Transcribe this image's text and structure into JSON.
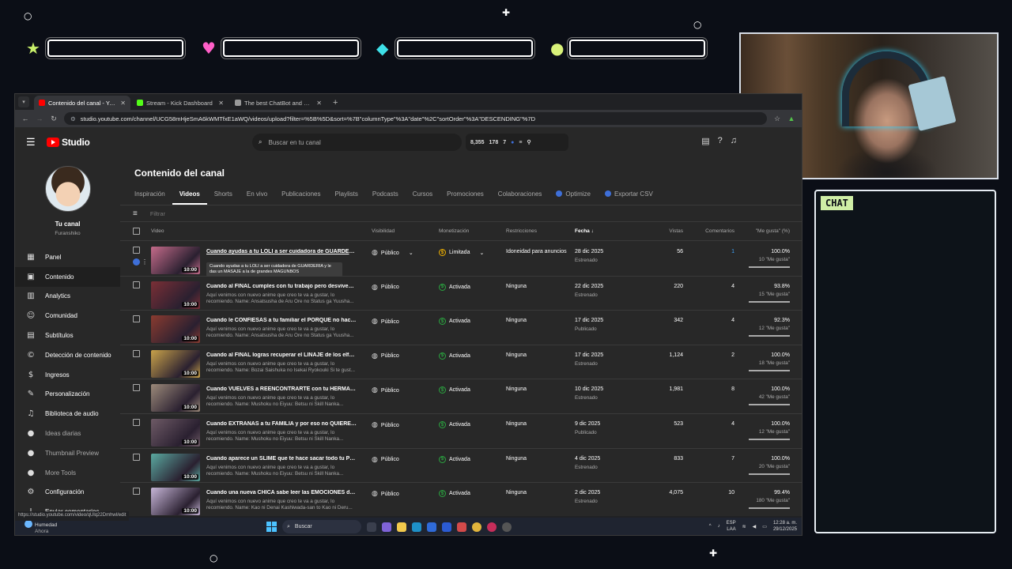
{
  "overlay": {
    "chat_label": "CHAT",
    "stat_icons": [
      "star-icon",
      "heart-icon",
      "gem-icon",
      "orb-icon"
    ],
    "colors": {
      "star": "#c8f06a",
      "heart": "#ff5fc8",
      "gem": "#3ee0e8",
      "orb": "#d9f27a"
    }
  },
  "browser": {
    "tabs": [
      {
        "title": "Contenido del canal - YouTube",
        "active": true,
        "favicon_color": "#ff0000"
      },
      {
        "title": "Stream - Kick Dashboard",
        "active": false,
        "favicon_color": "#53fc18"
      },
      {
        "title": "The best ChatBot and Widgets",
        "active": false,
        "favicon_color": "#999999"
      }
    ],
    "url": "studio.youtube.com/channel/UCG58mHjeSmA6kWMTfxE1aWQ/videos/upload?filter=%5B%5D&sort=%7B\"columnType\"%3A\"date\"%2C\"sortOrder\"%3A\"DESCENDING\"%7D",
    "status_url": "https://studio.youtube.com/video/qUlq22Dmhwl/edit"
  },
  "studio": {
    "logo_text": "Studio",
    "search_placeholder": "Buscar en tu canal",
    "stats": [
      "8,355",
      "178",
      "7"
    ],
    "channel": {
      "title": "Tu canal",
      "name": "Furanshiko"
    },
    "menu": [
      {
        "label": "Panel",
        "icon": "dashboard-icon",
        "glyph": "▦"
      },
      {
        "label": "Contenido",
        "icon": "content-icon",
        "glyph": "▣",
        "active": true
      },
      {
        "label": "Analytics",
        "icon": "analytics-icon",
        "glyph": "▥"
      },
      {
        "label": "Comunidad",
        "icon": "community-icon",
        "glyph": "☺"
      },
      {
        "label": "Subtítulos",
        "icon": "subtitles-icon",
        "glyph": "▤"
      },
      {
        "label": "Detección de contenido",
        "icon": "copyright-icon",
        "glyph": "©"
      },
      {
        "label": "Ingresos",
        "icon": "earn-icon",
        "glyph": "$"
      },
      {
        "label": "Personalización",
        "icon": "customization-icon",
        "glyph": "✎"
      },
      {
        "label": "Biblioteca de audio",
        "icon": "audio-library-icon",
        "glyph": "♫"
      },
      {
        "label": "Ideas diarias",
        "icon": "ideas-icon",
        "glyph": "●",
        "dim": true
      },
      {
        "label": "Thumbnail Preview",
        "icon": "thumbnail-preview-icon",
        "glyph": "●",
        "dim": true
      },
      {
        "label": "More Tools",
        "icon": "more-tools-icon",
        "glyph": "●",
        "dim": true
      },
      {
        "label": "Configuración",
        "icon": "settings-icon",
        "glyph": "⚙"
      },
      {
        "label": "Enviar comentarios",
        "icon": "feedback-icon",
        "glyph": "!"
      }
    ],
    "page_title": "Contenido del canal",
    "tabs": [
      "Inspiración",
      "Videos",
      "Shorts",
      "En vivo",
      "Publicaciones",
      "Playlists",
      "Podcasts",
      "Cursos",
      "Promociones",
      "Colaboraciones",
      "Optimize",
      "Exportar CSV"
    ],
    "filter_placeholder": "Filtrar",
    "columns": {
      "video": "Video",
      "visibility": "Visibilidad",
      "monetization": "Monetización",
      "restrictions": "Restricciones",
      "date": "Fecha",
      "views": "Vistas",
      "comments": "Comentarios",
      "likes": "\"Me gusta\" (%)"
    },
    "tooltip": "Cuando ayudas a tu LOLI a ser cuidadora de GUARDERIA y le das un MASAJE a la de grandes MAGUNBOS",
    "videos": [
      {
        "title": "Cuando ayudas a tu LOLI a ser cuidadora de GUARDERIA y le ...",
        "desc": "",
        "duration": "10:00",
        "visibility": "Público",
        "monetization": "Limitada",
        "restriction": "Idoneidad para anuncios",
        "date": "28 dic 2025",
        "status": "Estrenado",
        "views": "56",
        "comments": "1",
        "likes_pct": "100.0%",
        "likes": "10 \"Me gusta\"",
        "thumb": "#c46b8a"
      },
      {
        "title": "Cuando al FINAL cumples con tu trabajo pero desvives al LO...",
        "desc": "Aquí venimos con nuevo anime que creo te va a gustar, lo recomiendo. Name: Ansatsusha de Aru Ore no Status ga Yuusha...",
        "duration": "10:00",
        "visibility": "Público",
        "monetization": "Activada",
        "restriction": "Ninguna",
        "date": "22 dic 2025",
        "status": "Estrenado",
        "views": "220",
        "comments": "4",
        "likes_pct": "93.8%",
        "likes": "15 \"Me gusta\"",
        "thumb": "#7a2f36"
      },
      {
        "title": "Cuando le CONFIESAS a tu familiar el PORQUE no haces tu tr...",
        "desc": "Aquí venimos con nuevo anime que creo te va a gustar, lo recomiendo. Name: Ansatsusha de Aru Ore no Status ga Yuusha...",
        "duration": "10:00",
        "visibility": "Público",
        "monetization": "Activada",
        "restriction": "Ninguna",
        "date": "17 dic 2025",
        "status": "Publicado",
        "views": "342",
        "comments": "4",
        "likes_pct": "92.3%",
        "likes": "12 \"Me gusta\"",
        "thumb": "#8a3b30"
      },
      {
        "title": "Cuando al FINAL logras recuperar el LINAJE de los elfos y de...",
        "desc": "Aquí venimos con nuevo anime que creo te va a gustar, lo recomiendo. Name: Bozai Saishuka no Isekai Ryokouki Si te gust...",
        "duration": "10:00",
        "visibility": "Público",
        "monetization": "Activada",
        "restriction": "Ninguna",
        "date": "17 dic 2025",
        "status": "Estrenado",
        "views": "1,124",
        "comments": "2",
        "likes_pct": "100.0%",
        "likes": "18 \"Me gusta\"",
        "thumb": "#c9a24a"
      },
      {
        "title": "Cuando VUELVES a REENCONTRARTE con tu HERMANA per...",
        "desc": "Aquí venimos con nuevo anime que creo te va a gustar, lo recomiendo. Name: Mushoku no Eiyuu: Betsu ni Skill Nanka...",
        "duration": "10:00",
        "visibility": "Público",
        "monetization": "Activada",
        "restriction": "Ninguna",
        "date": "10 dic 2025",
        "status": "Estrenado",
        "views": "1,981",
        "comments": "8",
        "likes_pct": "100.0%",
        "likes": "42 \"Me gusta\"",
        "thumb": "#9c8a7a"
      },
      {
        "title": "Cuando EXTRAÑAS a tu FAMILIA y por eso no QUIERES hace...",
        "desc": "Aquí venimos con nuevo anime que creo te va a gustar, lo recomiendo. Name: Mushoku no Eiyuu: Betsu ni Skill Nanka...",
        "duration": "10:00",
        "visibility": "Público",
        "monetization": "Activada",
        "restriction": "Ninguna",
        "date": "9 dic 2025",
        "status": "Publicado",
        "views": "523",
        "comments": "4",
        "likes_pct": "100.0%",
        "likes": "12 \"Me gusta\"",
        "thumb": "#6e5a66"
      },
      {
        "title": "Cuando aparece un SLIME que te hace sacar todo tu POTEN...",
        "desc": "Aquí venimos con nuevo anime que creo te va a gustar, lo recomiendo. Name: Mushoku no Eiyuu: Betsu ni Skill Nanka...",
        "duration": "10:00",
        "visibility": "Público",
        "monetization": "Activada",
        "restriction": "Ninguna",
        "date": "4 dic 2025",
        "status": "Estrenado",
        "views": "833",
        "comments": "7",
        "likes_pct": "100.0%",
        "likes": "20 \"Me gusta\"",
        "thumb": "#5aa9a0"
      },
      {
        "title": "Cuando una nueva CHICA sabe leer las EMOCIONES de tu wa...",
        "desc": "Aquí venimos con nuevo anime que creo te va a gustar, lo recomiendo. Name: Kao ni Denai Kashiwada-san to Kao ni Deru...",
        "duration": "10:00",
        "visibility": "Público",
        "monetization": "Activada",
        "restriction": "Ninguna",
        "date": "2 dic 2025",
        "status": "Estrenado",
        "views": "4,075",
        "comments": "10",
        "likes_pct": "99.4%",
        "likes": "180 \"Me gusta\"",
        "thumb": "#c7b6d8"
      }
    ]
  },
  "taskbar": {
    "weather_title": "Humedad",
    "weather_sub": "Ahora",
    "search_label": "Buscar",
    "lang": "ESP",
    "lang_sub": "LAA",
    "time": "12:28 a. m.",
    "date": "29/12/2025"
  }
}
